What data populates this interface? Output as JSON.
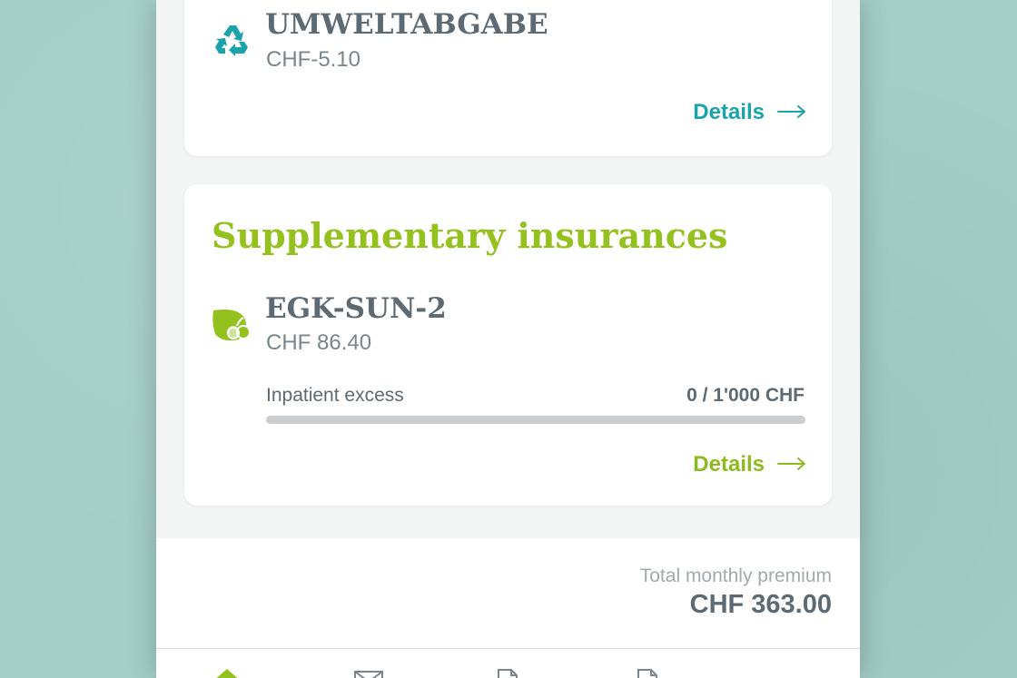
{
  "health_items": [
    {
      "name": "UMWELTABGABE",
      "price": "CHF-5.10",
      "icon": "recycle-icon",
      "details_label": "Details"
    }
  ],
  "supplementary": {
    "title": "Supplementary insurances",
    "item": {
      "name": "EGK-SUN-2",
      "price": "CHF 86.40",
      "icon": "leaf-fruit-icon",
      "excess_label": "Inpatient excess",
      "excess_value": "0 / 1'000 CHF",
      "excess_fraction": 0,
      "details_label": "Details"
    }
  },
  "total": {
    "label": "Total monthly premium",
    "value": "CHF 363.00"
  },
  "nav": [
    {
      "icon": "home-icon",
      "active": true
    },
    {
      "icon": "mail-icon",
      "active": false
    },
    {
      "icon": "document-icon",
      "active": false
    },
    {
      "icon": "invoice-icon",
      "active": false
    }
  ],
  "colors": {
    "teal_accent": "#1ba3ab",
    "green_accent": "#95c11f",
    "text_dark": "#5d6a73",
    "background": "#a3cdc7"
  }
}
